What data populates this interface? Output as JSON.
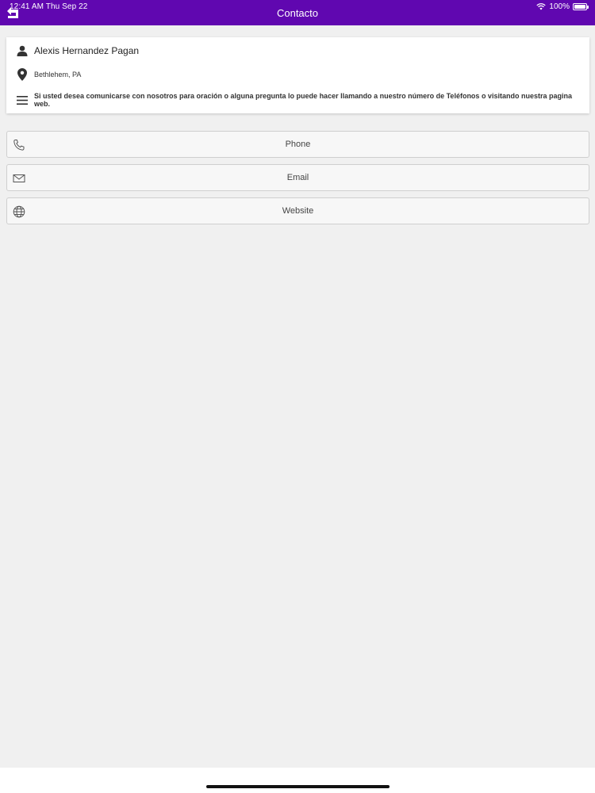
{
  "status_bar": {
    "time_date": "12:41 AM   Thu Sep 22",
    "battery": "100%",
    "battery_level": 1.0
  },
  "header": {
    "title": "Contacto",
    "back_icon": "back-arrow-icon",
    "background_color": "#6007b0"
  },
  "contact": {
    "name": "Alexis Hernandez Pagan",
    "location": "Bethlehem, PA",
    "description": "Si usted desea comunicarse con nosotros para oración o alguna pregunta lo puede hacer llamando a nuestro número de Teléfonos o visitando nuestra pagina web."
  },
  "actions": [
    {
      "label": "Phone",
      "icon": "phone-icon"
    },
    {
      "label": "Email",
      "icon": "envelope-icon"
    },
    {
      "label": "Website",
      "icon": "globe-icon"
    }
  ]
}
